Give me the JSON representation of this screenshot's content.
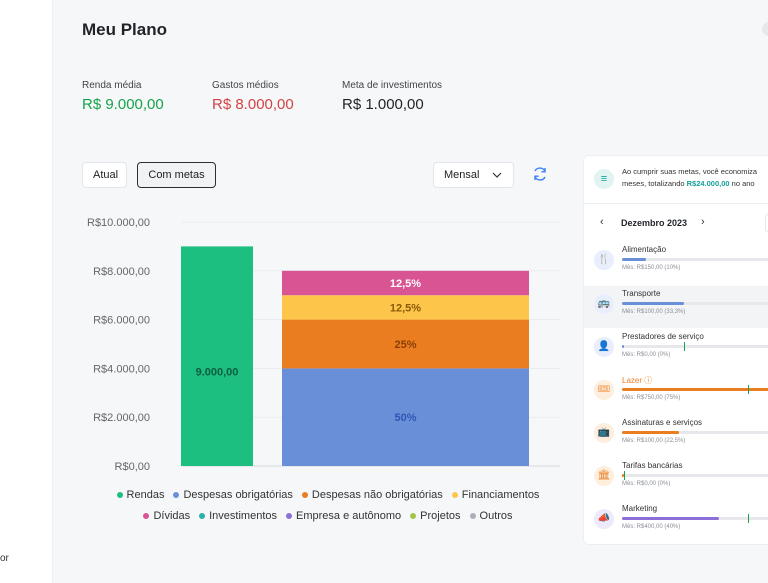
{
  "left_rail": {
    "stub_text": "or"
  },
  "header": {
    "title": "Meu Plano"
  },
  "stats": [
    {
      "label": "Renda média",
      "value": "R$ 9.000,00",
      "color": "#16a34a"
    },
    {
      "label": "Gastos médios",
      "value": "R$ 8.000,00",
      "color": "#d14343"
    },
    {
      "label": "Meta de investimentos",
      "value": "R$ 1.000,00",
      "color": "#1f2328"
    }
  ],
  "toolbar": {
    "atual_label": "Atual",
    "metas_label": "Com metas",
    "period_label": "Mensal",
    "period_chevron": "chevron-down-icon",
    "refresh_icon": "refresh-icon"
  },
  "chart_data": {
    "type": "bar",
    "stacked": true,
    "ylim": [
      0,
      10000
    ],
    "yticks": [
      "R$0,00",
      "R$2.000,00",
      "R$4.000,00",
      "R$6.000,00",
      "R$8.000,00",
      "R$10.000,00"
    ],
    "ytick_values": [
      0,
      2000,
      4000,
      6000,
      8000,
      10000
    ],
    "grid": true,
    "legend_position": "bottom",
    "bars": [
      {
        "segments": [
          {
            "name": "Rendas",
            "value": 9000,
            "label": "9.000,00",
            "color": "#1cbf7f"
          }
        ]
      },
      {
        "segments": [
          {
            "name": "Despesas obrigatórias",
            "value": 4000,
            "label": "50%",
            "color": "#6a8fd9"
          },
          {
            "name": "Despesas não obrigatórias",
            "value": 2000,
            "label": "25%",
            "color": "#ea7d1f"
          },
          {
            "name": "Financiamentos",
            "value": 1000,
            "label": "12,5%",
            "color": "#fdc54a"
          },
          {
            "name": "Dívidas",
            "value": 1000,
            "label": "12,5%",
            "color": "#d85493"
          }
        ]
      }
    ],
    "legend": [
      [
        {
          "name": "Rendas",
          "color": "#1cbf7f"
        },
        {
          "name": "Despesas obrigatórias",
          "color": "#6a8fd9"
        },
        {
          "name": "Despesas não obrigatórias",
          "color": "#ea7d1f"
        },
        {
          "name": "Financiamentos",
          "color": "#fdc54a"
        }
      ],
      [
        {
          "name": "Dívidas",
          "color": "#d85493"
        },
        {
          "name": "Investimentos",
          "color": "#2ab0a8"
        },
        {
          "name": "Empresa e autônomo",
          "color": "#8b6fd8"
        },
        {
          "name": "Projetos",
          "color": "#a5c24a"
        },
        {
          "name": "Outros",
          "color": "#a9b0b8"
        }
      ]
    ]
  },
  "panel": {
    "banner_line1": "Ao cumprir suas metas, você economiza",
    "banner_line2_pre": "meses, totalizando ",
    "banner_highlight": "R$24.000,00",
    "banner_line2_post": " no ano",
    "month": "Dezembro 2023",
    "categories": [
      {
        "name": "Alimentação",
        "sub": "Mês: R$150,00 (10%)",
        "fill": 0.15,
        "fill_color": "#6a8fd9",
        "icon": "fork-knife-icon",
        "icon_bg": "#e8eefb",
        "icon_fg": "#4b6fc7"
      },
      {
        "name": "Transporte",
        "sub": "Mês: R$100,00 (33,3%)",
        "fill": 0.38,
        "fill_color": "#6a8fd9",
        "icon": "bus-icon",
        "icon_bg": "#e8eefb",
        "icon_fg": "#4b6fc7"
      },
      {
        "name": "Prestadores de serviço",
        "sub": "Mês: R$0,00 (0%)",
        "fill": 0.01,
        "fill_color": "#6a8fd9",
        "marker": 0.38,
        "icon": "person-icon",
        "icon_bg": "#e8eefb",
        "icon_fg": "#4b6fc7"
      },
      {
        "name": "Lazer",
        "sub": "Mês: R$750,00 (75%)",
        "fill": 1.0,
        "fill_color": "#ea7d1f",
        "marker": 0.78,
        "name_color": "#ea7d1f",
        "warn": "ⓘ",
        "icon": "ticket-icon",
        "icon_bg": "#fdeede",
        "icon_fg": "#ea7d1f"
      },
      {
        "name": "Assinaturas e serviços",
        "sub": "Mês: R$100,00 (22,5%)",
        "fill": 0.35,
        "fill_color": "#ea7d1f",
        "icon": "tv-icon",
        "icon_bg": "#fdeede",
        "icon_fg": "#ea7d1f"
      },
      {
        "name": "Tarifas bancárias",
        "sub": "Mês: R$0,00 (0%)",
        "fill": 0.01,
        "fill_color": "#ea7d1f",
        "marker": 0.01,
        "icon": "bank-icon",
        "icon_bg": "#fdeede",
        "icon_fg": "#ea7d1f"
      },
      {
        "name": "Marketing",
        "sub": "Mês: R$400,00 (40%)",
        "fill": 0.6,
        "fill_color": "#8b6fd8",
        "marker": 0.78,
        "icon": "megaphone-icon",
        "icon_bg": "#eee9fb",
        "icon_fg": "#6b4fc7"
      }
    ]
  }
}
